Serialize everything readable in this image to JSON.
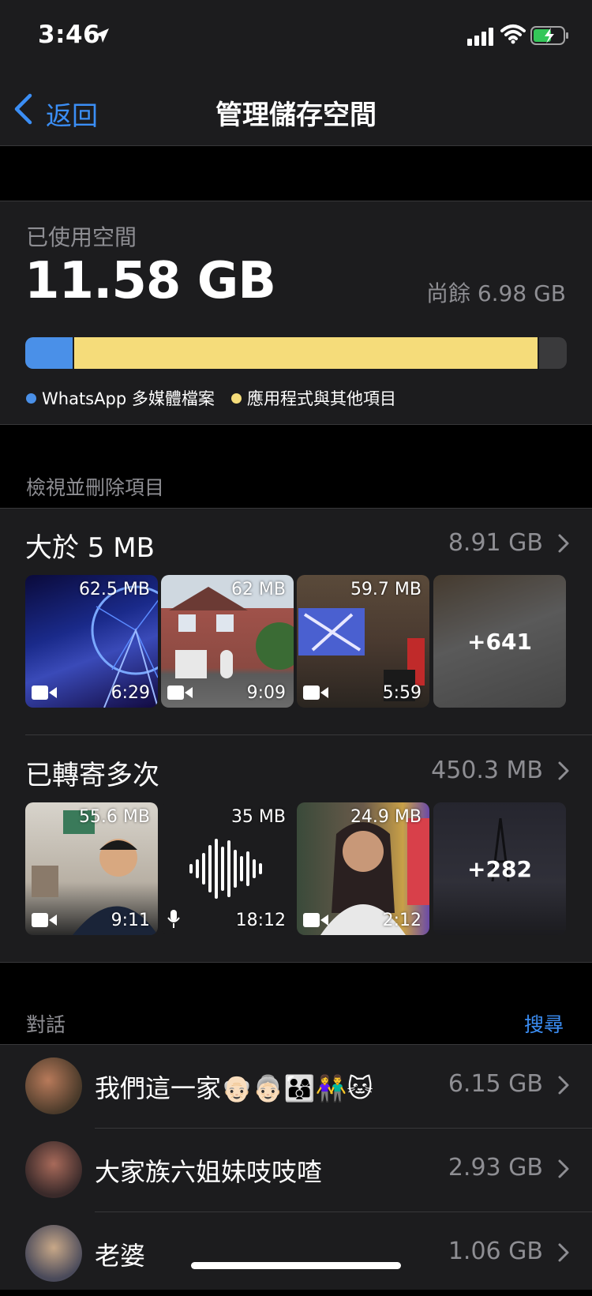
{
  "status_bar": {
    "time": "3:46"
  },
  "nav": {
    "back_label": "返回",
    "title": "管理儲存空間"
  },
  "storage": {
    "used_label": "已使用空間",
    "used_value": "11.58 GB",
    "remaining": "尚餘 6.98 GB",
    "media_fraction": 0.087,
    "apps_fraction": 0.862,
    "legend": [
      {
        "label": "WhatsApp 多媒體檔案",
        "color": "#4a90e8"
      },
      {
        "label": "應用程式與其他項目",
        "color": "#f5dc7a"
      }
    ]
  },
  "review": {
    "header": "檢視並刪除項目",
    "large": {
      "title": "大於 5 MB",
      "size": "8.91 GB",
      "tiles": [
        {
          "size": "62.5 MB",
          "duration": "6:29",
          "icon": "video-icon"
        },
        {
          "size": "62 MB",
          "duration": "9:09",
          "icon": "video-icon"
        },
        {
          "size": "59.7 MB",
          "duration": "5:59",
          "icon": "video-icon"
        },
        {
          "more": "+641"
        }
      ]
    },
    "forwarded": {
      "title": "已轉寄多次",
      "size": "450.3 MB",
      "tiles": [
        {
          "size": "55.6 MB",
          "duration": "9:11",
          "icon": "video-icon"
        },
        {
          "size": "35 MB",
          "duration": "18:12",
          "icon": "mic-icon"
        },
        {
          "size": "24.9 MB",
          "duration": "2:12",
          "icon": "video-icon"
        },
        {
          "more": "+282"
        }
      ]
    }
  },
  "chats": {
    "header": "對話",
    "search_label": "搜尋",
    "items": [
      {
        "name": "我們這一家👴🏻👵🏻👨‍👩‍👦👫🐱",
        "size": "6.15 GB"
      },
      {
        "name": "大家族六姐妹吱吱喳",
        "size": "2.93 GB"
      },
      {
        "name": "老婆",
        "size": "1.06 GB"
      }
    ]
  }
}
